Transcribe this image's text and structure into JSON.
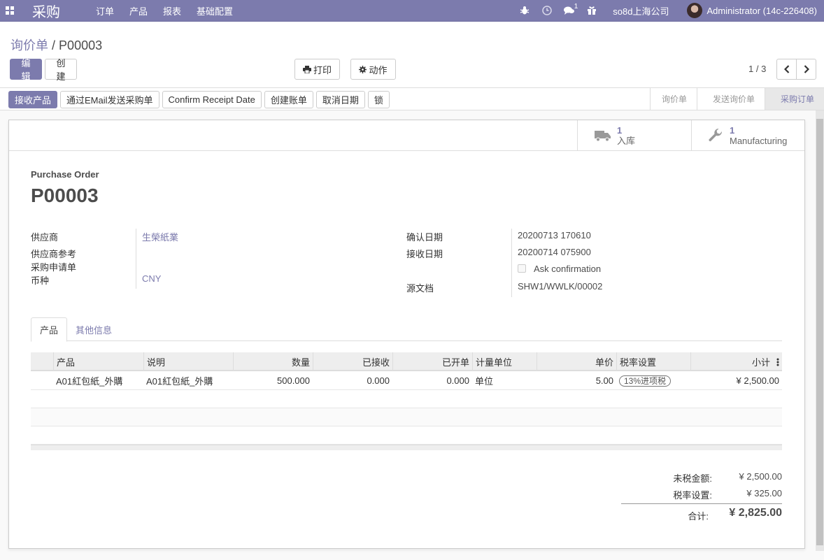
{
  "navbar": {
    "app_name": "采购",
    "menu": [
      "订单",
      "产品",
      "报表",
      "基础配置"
    ],
    "messages_badge": "1",
    "company": "so8d上海公司",
    "user": "Administrator (14c-226408)"
  },
  "breadcrumb": {
    "parent": "询价单",
    "separator": "/",
    "current": "P00003"
  },
  "buttons": {
    "edit": "编辑",
    "create": "创建",
    "print": "打印",
    "action": "动作"
  },
  "pager": {
    "value": "1 / 3"
  },
  "statusbar": {
    "buttons": [
      "接收产品",
      "通过EMail发送采购单",
      "Confirm Receipt Date",
      "创建账单",
      "取消日期",
      "锁"
    ],
    "stages": [
      "询价单",
      "发送询价单",
      "采购订单"
    ],
    "active_stage": "采购订单"
  },
  "smart_buttons": {
    "delivery": {
      "count": "1",
      "label": "入库"
    },
    "manufacturing": {
      "count": "1",
      "label": "Manufacturing"
    }
  },
  "form": {
    "doc_type": "Purchase Order",
    "name": "P00003",
    "left": {
      "vendor_label": "供应商",
      "vendor_value": "生榮紙業",
      "vendor_ref_label": "供应商参考",
      "requisition_label": "采购申请单",
      "currency_label": "币种",
      "currency_value": "CNY"
    },
    "right": {
      "confirm_date_label": "确认日期",
      "confirm_date_value": "20200713 170610",
      "receipt_date_label": "接收日期",
      "receipt_date_value": "20200714 075900",
      "ask_confirmation_label": "Ask confirmation",
      "source_label": "源文档",
      "source_value": "SHW1/WWLK/00002"
    }
  },
  "tabs": [
    "产品",
    "其他信息"
  ],
  "table": {
    "headers": [
      "产品",
      "说明",
      "数量",
      "已接收",
      "已开单",
      "计量单位",
      "单价",
      "税率设置",
      "小计"
    ],
    "rows": [
      [
        "A01紅包紙_外購",
        "A01紅包紙_外購",
        "500.000",
        "0.000",
        "0.000",
        "单位",
        "5.00",
        "13%进项税",
        "¥ 2,500.00"
      ]
    ]
  },
  "totals": {
    "untaxed_label": "未税金额:",
    "untaxed_value": "¥ 2,500.00",
    "tax_label": "税率设置:",
    "tax_value": "¥ 325.00",
    "total_label": "合计:",
    "total_value": "¥ 2,825.00"
  }
}
